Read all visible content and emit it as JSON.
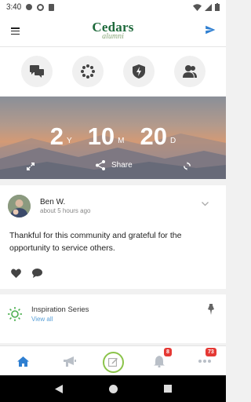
{
  "status_bar": {
    "time": "3:40"
  },
  "app_bar": {
    "logo_top": "Cedars",
    "logo_bottom": "alumni"
  },
  "shortcuts": [
    {
      "icon": "chat-bubbles-icon"
    },
    {
      "icon": "spinner-icon"
    },
    {
      "icon": "shield-bolt-icon"
    },
    {
      "icon": "people-icon"
    }
  ],
  "countdown": {
    "years": "2",
    "years_label": "Y",
    "months": "10",
    "months_label": "M",
    "days": "20",
    "days_label": "D",
    "share_label": "Share"
  },
  "post": {
    "author": "Ben W.",
    "time": "about 5 hours ago",
    "body": "Thankful for this community and grateful for the opportunity to service others."
  },
  "inspiration": {
    "title": "Inspiration Series",
    "link": "View all"
  },
  "tabs": {
    "notifications_badge": "8",
    "more_badge": "73"
  },
  "colors": {
    "accent": "#2f7fd1",
    "brand_green": "#1f6a3c",
    "badge": "#e53935"
  }
}
